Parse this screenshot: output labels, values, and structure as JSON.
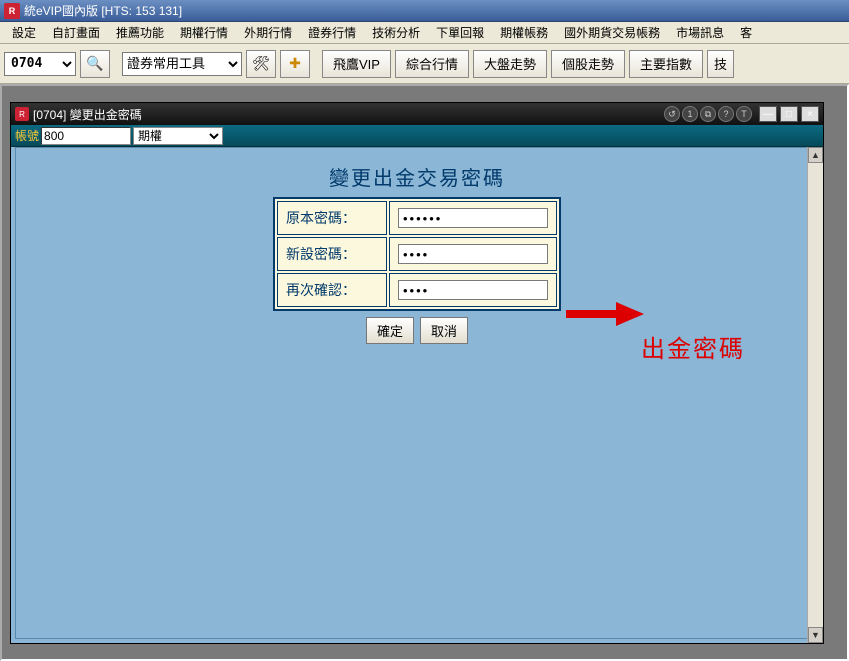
{
  "app": {
    "title": "統eVIP國內版  [HTS: 153 131]",
    "icon_text": "R"
  },
  "menu": {
    "items": [
      "設定",
      "自訂畫面",
      "推薦功能",
      "期權行情",
      "外期行情",
      "證券行情",
      "技術分析",
      "下單回報",
      "期權帳務",
      "國外期貨交易帳務",
      "市場訊息",
      "客"
    ]
  },
  "toolbar": {
    "code": "0704",
    "combo_label": "證券常用工具",
    "buttons": [
      "飛鷹VIP",
      "綜合行情",
      "大盤走勢",
      "個股走勢",
      "主要指數"
    ],
    "overflow": "技"
  },
  "inner_window": {
    "icon_text": "R",
    "title": "[0704] 變更出金密碼",
    "round_buttons": [
      "↺",
      "1",
      "⧉",
      "?",
      "T"
    ],
    "win_buttons": [
      "—",
      "□",
      "×"
    ]
  },
  "account_bar": {
    "label": "帳號",
    "account_value": "800",
    "select_value": "期權"
  },
  "form": {
    "title": "變更出金交易密碼",
    "rows": [
      {
        "label": "原本密碼：",
        "value": "••••••"
      },
      {
        "label": "新設密碼：",
        "value": "••••"
      },
      {
        "label": "再次確認：",
        "value": "••••"
      }
    ],
    "confirm": "確定",
    "cancel": "取消"
  },
  "annotation": {
    "text": "出金密碼"
  }
}
